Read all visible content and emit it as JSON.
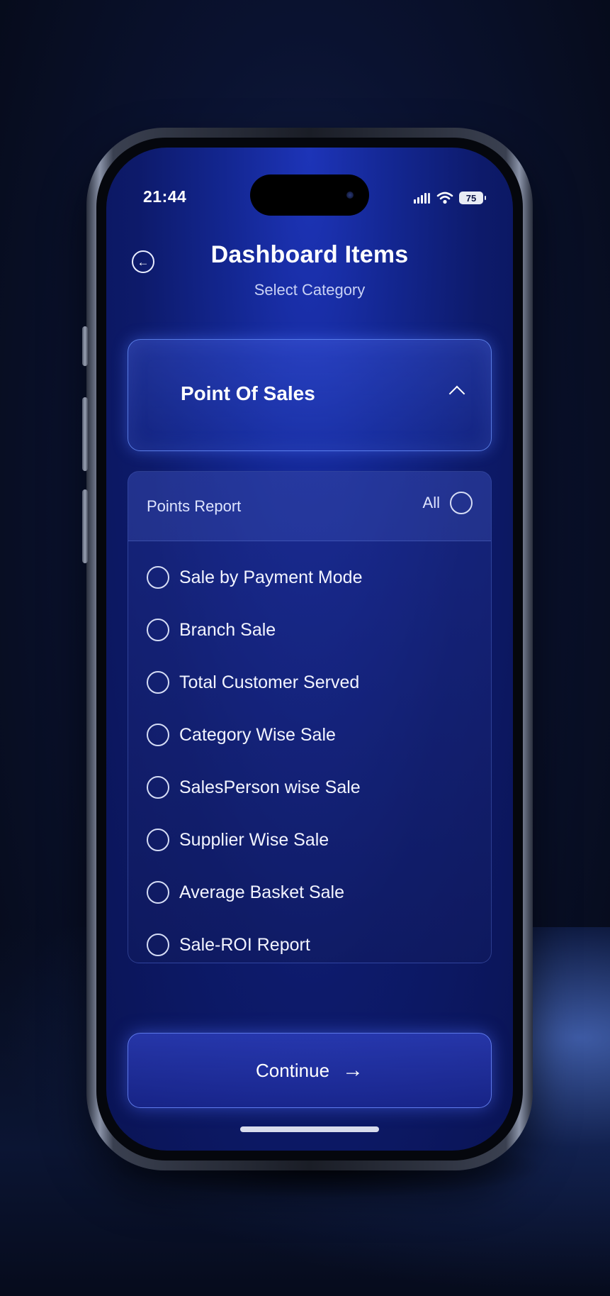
{
  "status": {
    "time": "21:44",
    "battery": "75"
  },
  "header": {
    "title": "Dashboard Items",
    "subtitle": "Select Category"
  },
  "dropdown": {
    "selected": "Point Of Sales"
  },
  "panel": {
    "title": "Points Report",
    "all_label": "All",
    "items": [
      {
        "label": "Sale by Payment Mode"
      },
      {
        "label": "Branch Sale"
      },
      {
        "label": "Total Customer Served"
      },
      {
        "label": "Category Wise Sale"
      },
      {
        "label": "SalesPerson wise Sale"
      },
      {
        "label": "Supplier Wise Sale"
      },
      {
        "label": "Average Basket Sale"
      },
      {
        "label": "Sale-ROI Report"
      }
    ]
  },
  "footer": {
    "continue_label": "Continue"
  },
  "icons": {
    "back": "arrow-left-circle-icon",
    "chevron": "chevron-up-icon",
    "continue": "arrow-right-icon",
    "signal": "signal-icon",
    "wifi": "wifi-icon",
    "battery": "battery-icon"
  },
  "colors": {
    "accent": "#4f6cff",
    "background": "#0d1a6a"
  }
}
